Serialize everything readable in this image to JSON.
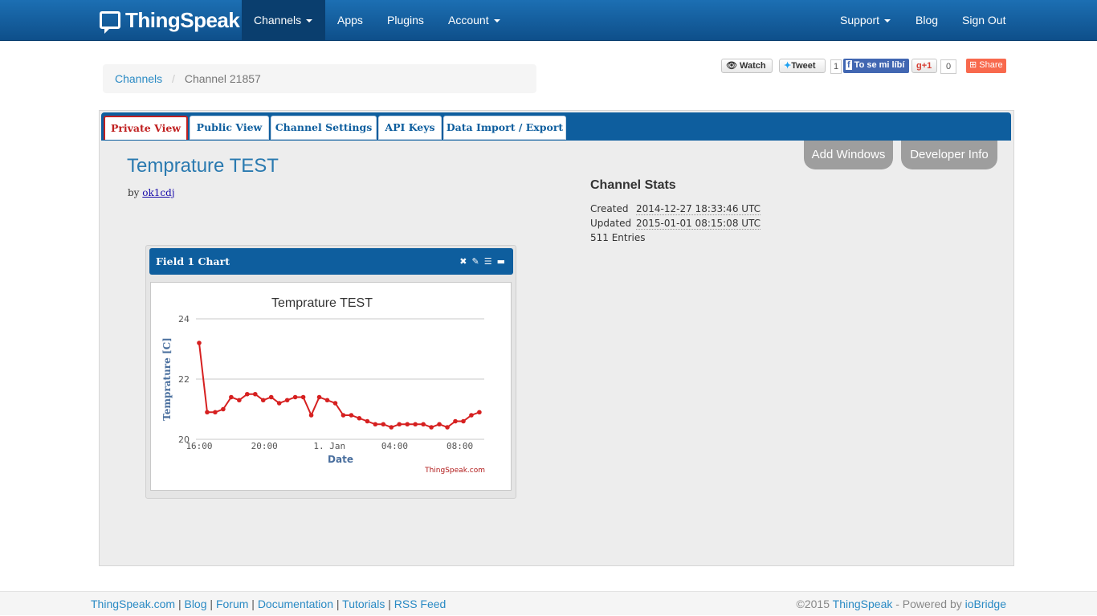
{
  "nav": {
    "brand": "ThingSpeak",
    "left": [
      "Channels",
      "Apps",
      "Plugins",
      "Account"
    ],
    "right": [
      "Support",
      "Blog",
      "Sign Out"
    ]
  },
  "breadcrumb": {
    "root": "Channels",
    "current": "Channel 21857"
  },
  "social": {
    "watch": "Watch",
    "tweet": "Tweet",
    "tweet_count": "1",
    "facebook": "To se mi líbí",
    "gplus": "+1",
    "gplus_count": "0",
    "share": "Share"
  },
  "tabs": [
    "Private View",
    "Public View",
    "Channel Settings",
    "API Keys",
    "Data Import / Export"
  ],
  "buttons": {
    "add_windows": "Add Windows",
    "developer_info": "Developer Info"
  },
  "channel": {
    "title": "Temprature TEST",
    "by_label": "by",
    "author": "ok1cdj"
  },
  "stats": {
    "heading": "Channel Stats",
    "created_label": "Created",
    "created": "2014-12-27 18:33:46 UTC",
    "updated_label": "Updated",
    "updated": "2015-01-01 08:15:08 UTC",
    "entries": "511 Entries"
  },
  "chart_window": {
    "title": "Field 1 Chart",
    "icons": [
      "close-icon",
      "edit-icon",
      "comment-icon",
      "minimize-icon"
    ]
  },
  "chart_data": {
    "type": "line",
    "title": "Temprature TEST",
    "xlabel": "Date",
    "ylabel": "Temprature [C]",
    "credit": "ThingSpeak.com",
    "ylim": [
      20,
      24
    ],
    "yticks": [
      20,
      22,
      24
    ],
    "xticks": [
      {
        "label": "16:00",
        "hours": 0
      },
      {
        "label": "20:00",
        "hours": 4
      },
      {
        "label": "1. Jan",
        "hours": 8
      },
      {
        "label": "04:00",
        "hours": 12
      },
      {
        "label": "08:00",
        "hours": 16
      }
    ],
    "x_range_hours": [
      0,
      17.5
    ],
    "line_color": "#d62020",
    "x_hours": [
      0,
      0.4,
      0.8,
      1.2,
      1.6,
      2.0,
      2.4,
      2.8,
      3.2,
      3.6,
      4.0,
      4.4,
      4.8,
      5.2,
      5.6,
      6.0,
      6.4,
      6.8,
      7.2,
      7.6,
      8.0,
      8.4,
      8.8,
      9.2,
      9.6,
      10.0,
      10.4,
      10.8,
      11.2,
      11.6,
      12.0,
      12.4,
      12.8,
      13.2,
      13.6,
      14.0,
      14.4,
      14.8,
      15.2,
      15.6,
      16.0,
      16.4,
      16.8,
      17.2
    ],
    "values": [
      23.2,
      20.9,
      20.9,
      21.0,
      21.4,
      21.3,
      21.5,
      21.5,
      21.3,
      21.4,
      21.2,
      21.3,
      21.4,
      21.4,
      20.8,
      21.4,
      21.3,
      21.2,
      20.8,
      20.8,
      20.7,
      20.6,
      20.5,
      20.5,
      20.4,
      20.5,
      20.5,
      20.5,
      20.5,
      20.4,
      20.5,
      20.4,
      20.6,
      20.6,
      20.8,
      20.9
    ]
  },
  "footer": {
    "links": [
      "ThingSpeak.com",
      "Blog",
      "Forum",
      "Documentation",
      "Tutorials",
      "RSS Feed"
    ],
    "copyright": "©2015",
    "brand_link": "ThingSpeak",
    "powered": "- Powered by",
    "powered_link": "ioBridge"
  }
}
